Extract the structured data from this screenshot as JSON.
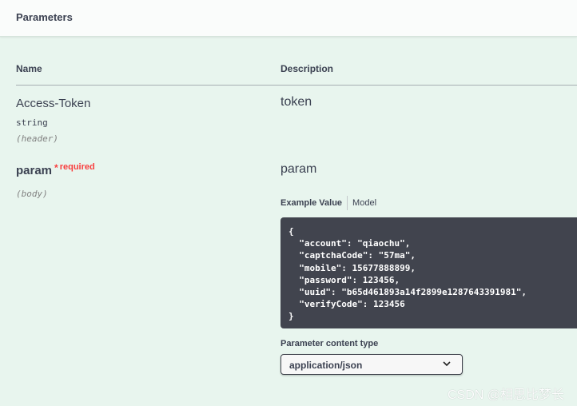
{
  "section": {
    "title": "Parameters"
  },
  "columns": {
    "name": "Name",
    "description": "Description"
  },
  "params": [
    {
      "name": "Access-Token",
      "required_mark": "",
      "required_label": "",
      "type": "string",
      "in": "(header)",
      "description": "token"
    },
    {
      "name": "param",
      "required_mark": "*",
      "required_label": "required",
      "type": "",
      "in": "(body)",
      "description": "param"
    }
  ],
  "example": {
    "tab_example": "Example Value",
    "tab_model": "Model",
    "code": "{\n  \"account\": \"qiaochu\",\n  \"captchaCode\": \"57ma\",\n  \"mobile\": 15677888899,\n  \"password\": 123456,\n  \"uuid\": \"b65d461893a14f2899e1287643391981\",\n  \"verifyCode\": 123456\n}"
  },
  "content_type": {
    "label": "Parameter content type",
    "selected": "application/json"
  },
  "watermark": "CSDN @相思比梦长",
  "colors": {
    "background": "#e8f5ee",
    "code_bg": "#41444e",
    "required": "#f93e3e",
    "text": "#3b4151"
  }
}
